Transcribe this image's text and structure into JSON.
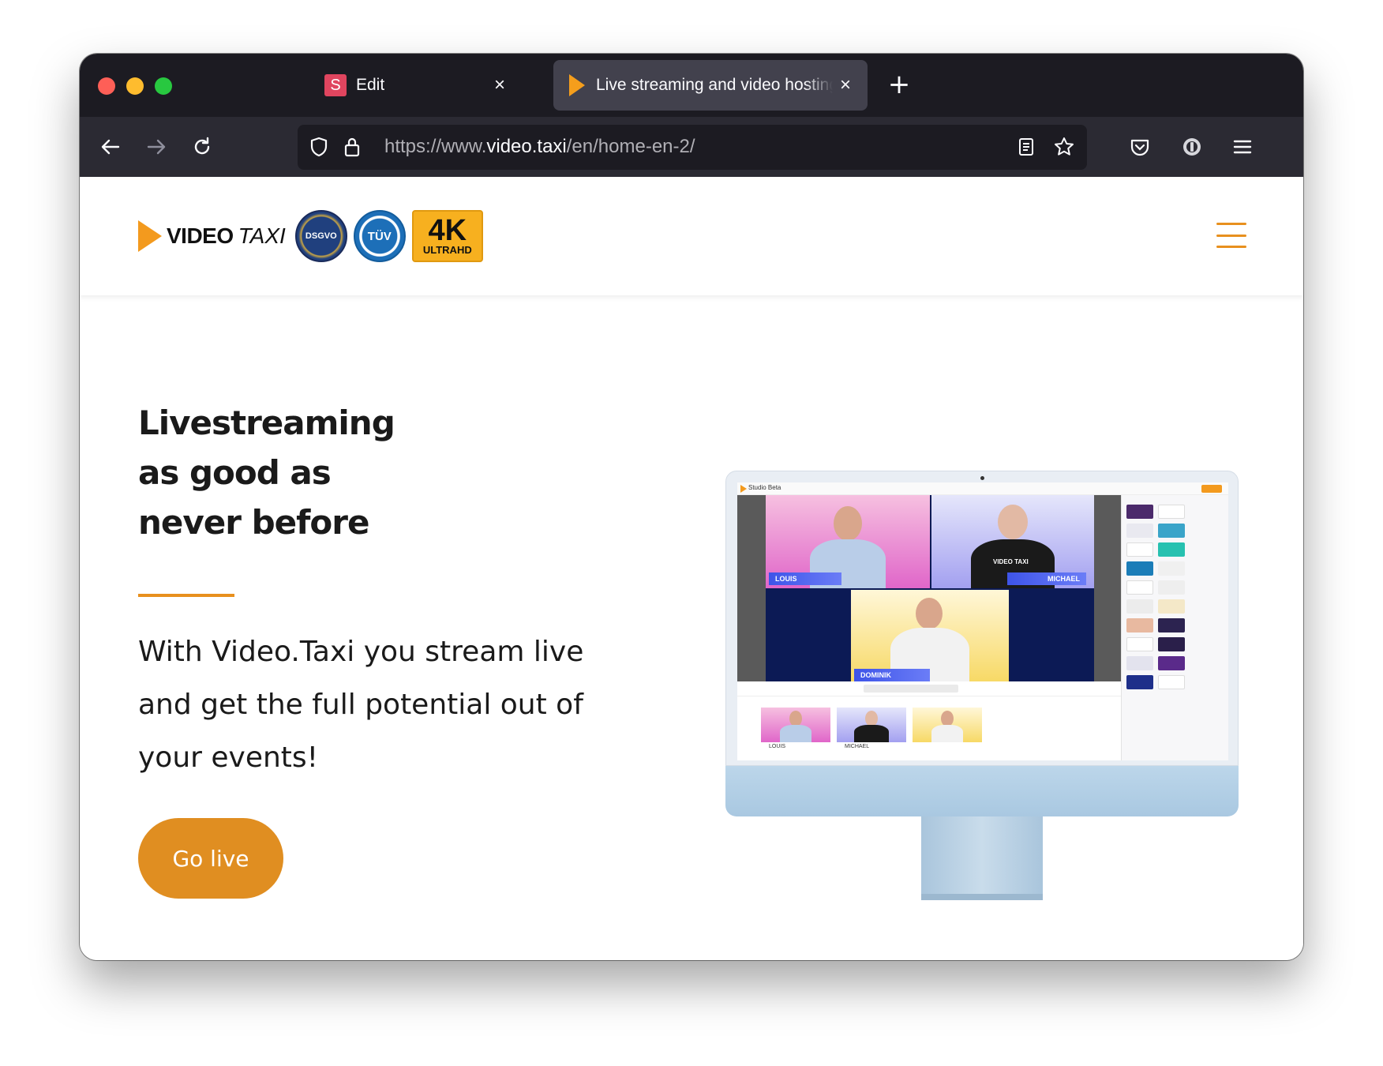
{
  "browser": {
    "tabs": [
      {
        "favicon_letter": "S",
        "title": "Edit"
      },
      {
        "title": "Live streaming and video hosting"
      }
    ],
    "url": {
      "scheme": "https://www.",
      "host": "video.taxi",
      "path": "/en/home-en-2/"
    }
  },
  "site": {
    "logo": {
      "bold": "VIDEO",
      "light": "TAXI"
    },
    "badges": {
      "dsgvo": "DSGVO",
      "tuv": "TÜV",
      "uhd_big": "4K",
      "uhd_small": "ULTRAHD"
    }
  },
  "hero": {
    "headline": [
      "Livestreaming",
      "as good as",
      "never before"
    ],
    "subtext": "With Video.Taxi you stream live and get the full potential out of your events!",
    "cta": "Go live"
  },
  "studio": {
    "app_label": "Studio Beta",
    "names": [
      "LOUIS",
      "MICHAEL",
      "DOMINIK"
    ],
    "shirt_logo": "VIDEO TAXI",
    "guest_labels": [
      "LOUIS",
      "MICHAEL"
    ]
  },
  "colors": {
    "accent": "#e08e21",
    "tab_bar": "#1c1b22",
    "nav_bar": "#2b2a33"
  }
}
